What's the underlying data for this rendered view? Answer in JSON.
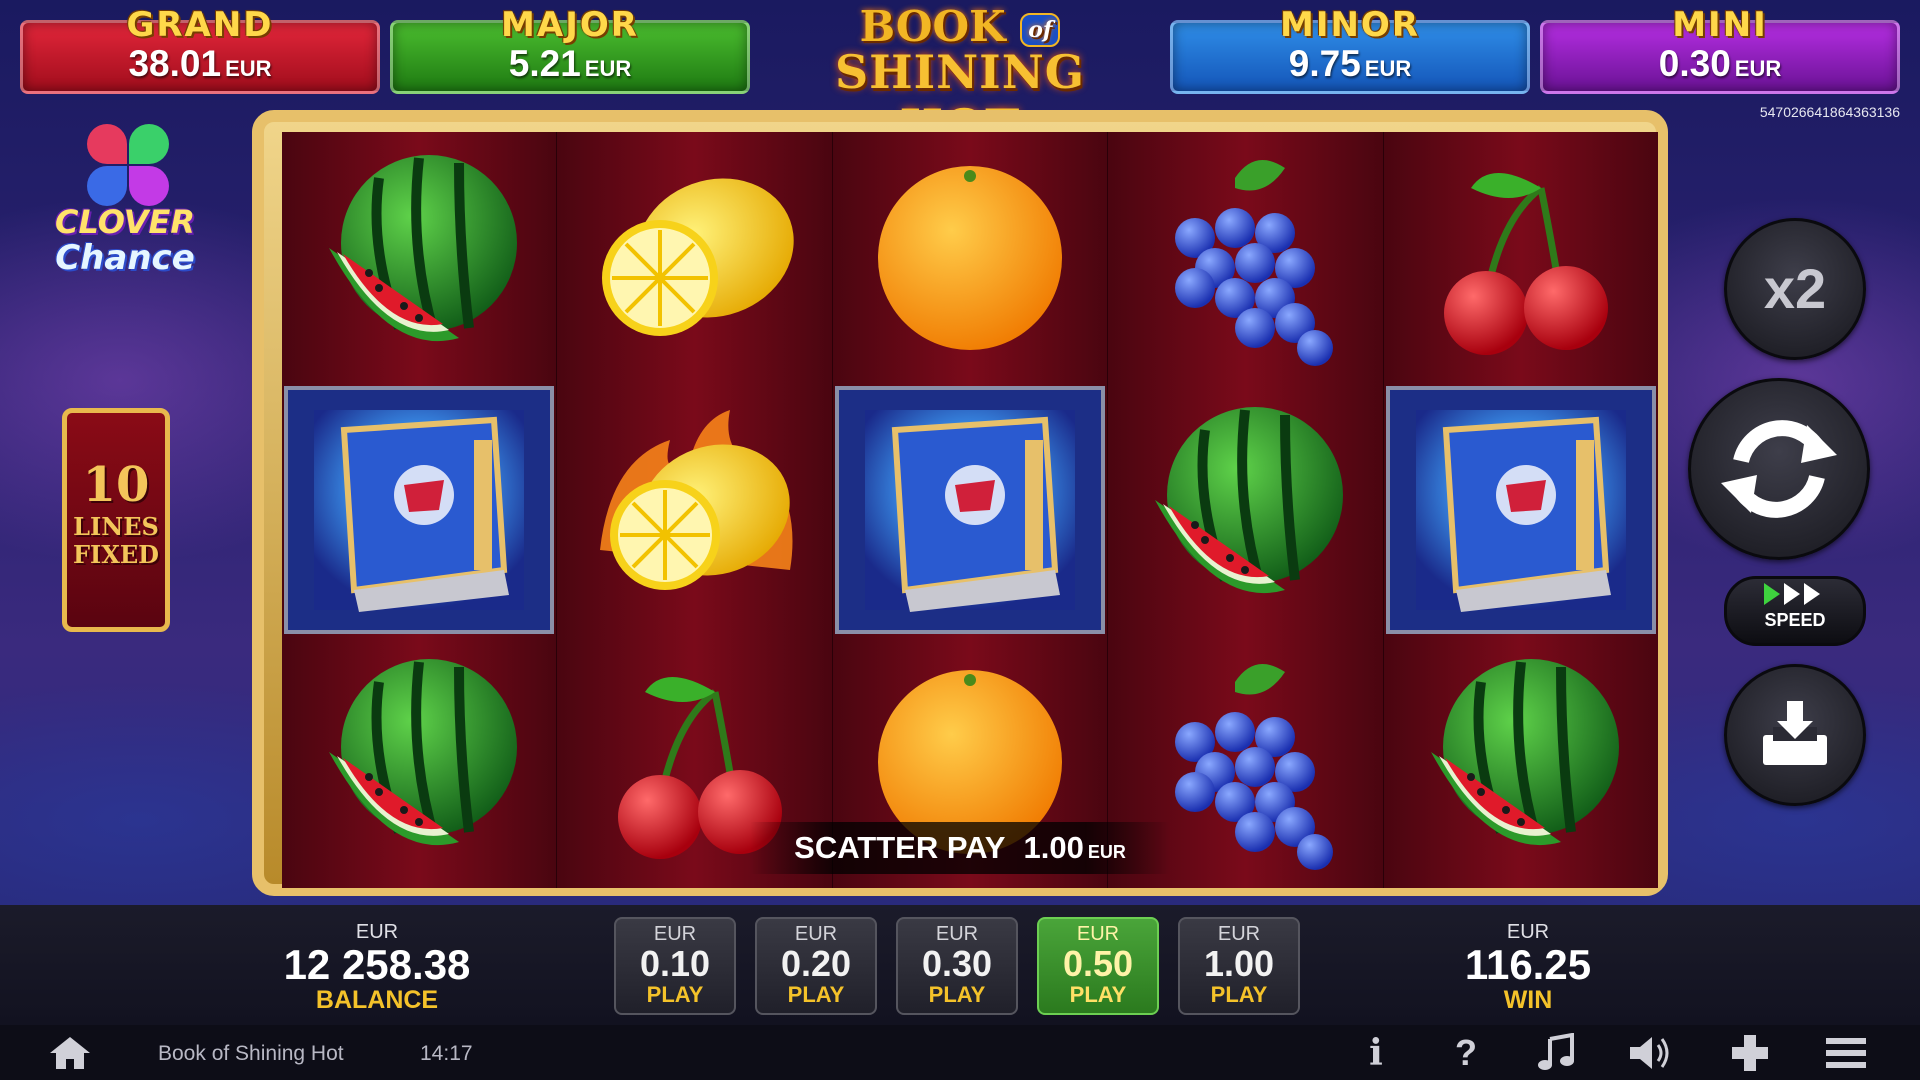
{
  "jackpots": [
    {
      "name": "GRAND",
      "value": "38.01",
      "currency": "EUR"
    },
    {
      "name": "MAJOR",
      "value": "5.21",
      "currency": "EUR"
    },
    {
      "name": "MINOR",
      "value": "9.75",
      "currency": "EUR"
    },
    {
      "name": "MINI",
      "value": "0.30",
      "currency": "EUR"
    }
  ],
  "logo": {
    "line1": "BOOK",
    "of": "of",
    "line2": "SHINING HOT"
  },
  "game_id": "547026641864363136",
  "clover": {
    "line1": "CLOVER",
    "line2": "Chance"
  },
  "lines": {
    "number": "10",
    "line1": "LINES",
    "line2": "FIXED"
  },
  "reels": [
    [
      "watermelon",
      "book",
      "watermelon"
    ],
    [
      "lemon",
      "burning-lemon",
      "cherry"
    ],
    [
      "orange",
      "book",
      "orange"
    ],
    [
      "grapes",
      "watermelon",
      "grapes"
    ],
    [
      "cherry",
      "book",
      "watermelon"
    ]
  ],
  "scatter": {
    "label": "SCATTER PAY",
    "amount": "1.00",
    "currency": "EUR"
  },
  "controls": {
    "multiplier": "x2",
    "speed_label": "SPEED"
  },
  "balance": {
    "currency": "EUR",
    "value": "12 258.38",
    "label": "BALANCE"
  },
  "win": {
    "currency": "EUR",
    "value": "116.25",
    "label": "WIN"
  },
  "bets": [
    {
      "currency": "EUR",
      "value": "0.10",
      "label": "PLAY",
      "active": false
    },
    {
      "currency": "EUR",
      "value": "0.20",
      "label": "PLAY",
      "active": false
    },
    {
      "currency": "EUR",
      "value": "0.30",
      "label": "PLAY",
      "active": false
    },
    {
      "currency": "EUR",
      "value": "0.50",
      "label": "PLAY",
      "active": true
    },
    {
      "currency": "EUR",
      "value": "1.00",
      "label": "PLAY",
      "active": false
    }
  ],
  "footer": {
    "game_name": "Book of Shining Hot",
    "time": "14:17"
  },
  "colors": {
    "accent_gold": "#f4c22a",
    "active_bet": "#4aa53a",
    "reel_bg": "#7a0a1a"
  }
}
